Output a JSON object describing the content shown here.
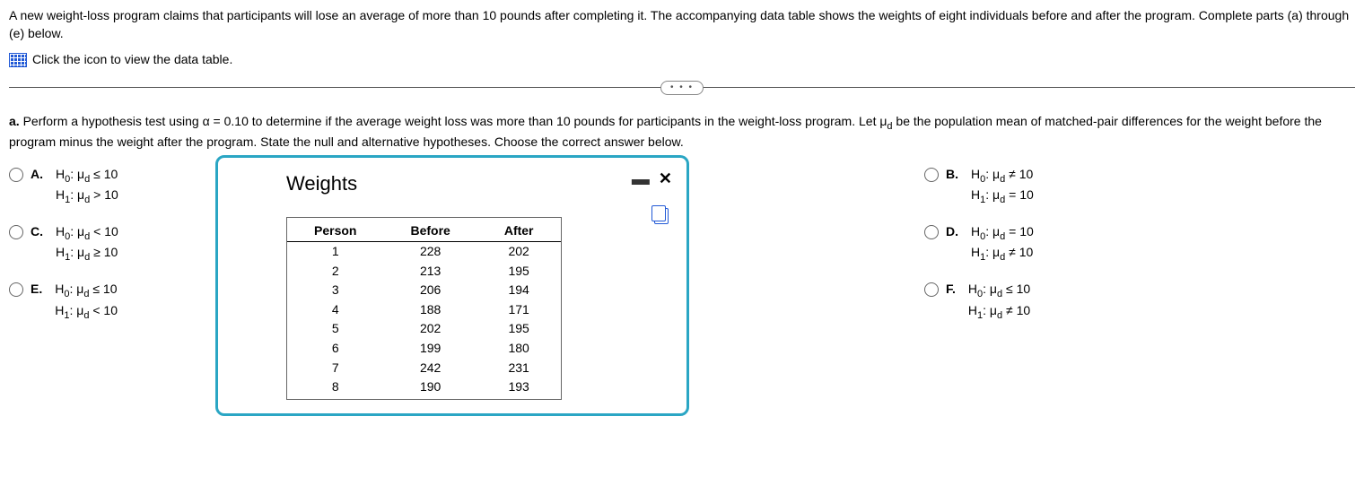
{
  "intro": "A new weight-loss program claims that participants will lose an average of more than 10 pounds after completing it. The accompanying data table shows the weights of eight individuals before and after the program. Complete parts (a) through (e) below.",
  "linkText": "Click the icon to view the data table.",
  "more": "• • •",
  "questionA": {
    "prefix": "a. ",
    "text1": "Perform a hypothesis test using α = 0.10 to determine if the average weight loss was more than 10 pounds for participants in the weight-loss program. Let μ",
    "sub1": "d",
    "text2": " be the population mean of matched-pair differences for the weight before the program minus the weight after the program. State the null and alternative hypotheses. Choose the correct answer below."
  },
  "options": {
    "A": {
      "label": "A.",
      "h0": "H₀: μd ≤ 10",
      "h1": "H₁: μd > 10"
    },
    "B": {
      "label": "B.",
      "h0": "H₀: μd ≠ 10",
      "h1": "H₁: μd = 10"
    },
    "C": {
      "label": "C.",
      "h0": "H₀: μd < 10",
      "h1": "H₁: μd ≥ 10"
    },
    "D": {
      "label": "D.",
      "h0": "H₀: μd = 10",
      "h1": "H₁: μd ≠ 10"
    },
    "E": {
      "label": "E.",
      "h0": "H₀: μd ≤ 10",
      "h1": "H₁: μd < 10"
    },
    "F": {
      "label": "F.",
      "h0": "H₀: μd ≤ 10",
      "h1": "H₁: μd ≠ 10"
    }
  },
  "popup": {
    "title": "Weights",
    "headers": {
      "c1": "Person",
      "c2": "Before",
      "c3": "After"
    },
    "rows": [
      {
        "p": "1",
        "b": "228",
        "a": "202"
      },
      {
        "p": "2",
        "b": "213",
        "a": "195"
      },
      {
        "p": "3",
        "b": "206",
        "a": "194"
      },
      {
        "p": "4",
        "b": "188",
        "a": "171"
      },
      {
        "p": "5",
        "b": "202",
        "a": "195"
      },
      {
        "p": "6",
        "b": "199",
        "a": "180"
      },
      {
        "p": "7",
        "b": "242",
        "a": "231"
      },
      {
        "p": "8",
        "b": "190",
        "a": "193"
      }
    ]
  }
}
